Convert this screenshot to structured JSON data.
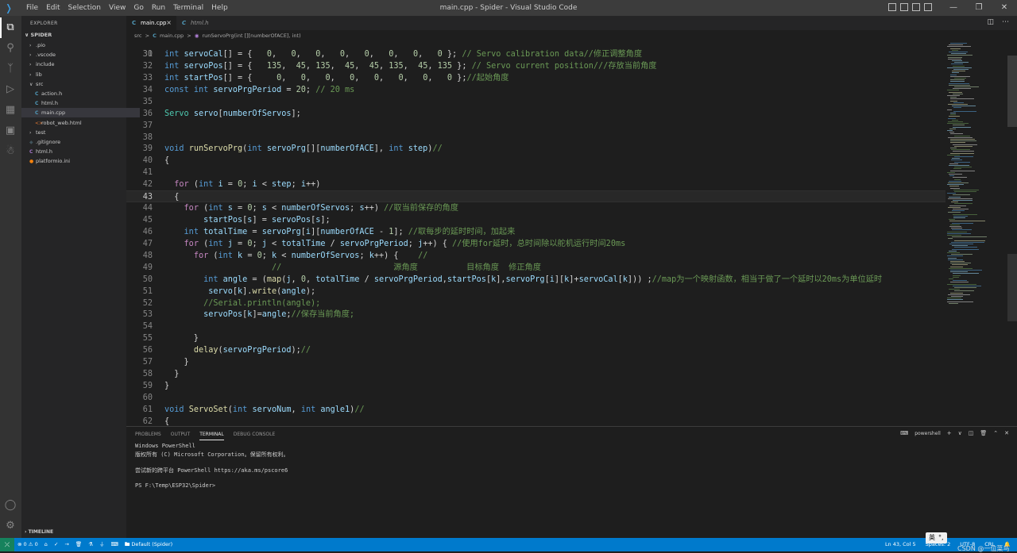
{
  "titlebar": {
    "menu": [
      "File",
      "Edit",
      "Selection",
      "View",
      "Go",
      "Run",
      "Terminal",
      "Help"
    ],
    "title": "main.cpp - Spider - Visual Studio Code"
  },
  "sidebar": {
    "title": "EXPLORER",
    "root": "SPIDER",
    "items": [
      {
        "label": ".pio",
        "type": "folder",
        "depth": 0
      },
      {
        "label": ".vscode",
        "type": "folder",
        "depth": 0
      },
      {
        "label": "include",
        "type": "folder",
        "depth": 0
      },
      {
        "label": "lib",
        "type": "folder",
        "depth": 0
      },
      {
        "label": "src",
        "type": "folder-open",
        "depth": 0
      },
      {
        "label": "action.h",
        "type": "c",
        "depth": 1
      },
      {
        "label": "html.h",
        "type": "c",
        "depth": 1
      },
      {
        "label": "main.cpp",
        "type": "c",
        "depth": 1,
        "selected": true
      },
      {
        "label": "robot_web.html",
        "type": "html",
        "depth": 1
      },
      {
        "label": "test",
        "type": "folder",
        "depth": 0
      },
      {
        "label": ".gitignore",
        "type": "git",
        "depth": 0
      },
      {
        "label": "html.h",
        "type": "h",
        "depth": 0
      },
      {
        "label": "platformio.ini",
        "type": "pio",
        "depth": 0
      }
    ],
    "timeline": "TIMELINE"
  },
  "tabs": [
    {
      "icon": "C",
      "label": "main.cpp"
    },
    {
      "icon": "C",
      "label": "html.h"
    }
  ],
  "breadcrumb": [
    "src",
    ">",
    "main.cpp",
    ">",
    "runServoPrg(int [][numberOfACE], int)"
  ],
  "editor": {
    "partial_line": "30",
    "lines": [
      {
        "n": "31",
        "code": "int servoCal[] = {   0,   0,   0,   0,   0,   0,   0,   0 }; // Servo calibration data//修正调整角度"
      },
      {
        "n": "32",
        "code": "int servoPos[] = {   135,  45, 135,  45,  45, 135,  45, 135 }; // Servo current position///存放当前角度"
      },
      {
        "n": "33",
        "code": "int startPos[] = {     0,   0,   0,   0,   0,   0,   0,   0 };//起始角度"
      },
      {
        "n": "34",
        "code": "const int servoPrgPeriod = 20; // 20 ms"
      },
      {
        "n": "35",
        "code": ""
      },
      {
        "n": "36",
        "code": "Servo servo[numberOfServos];"
      },
      {
        "n": "37",
        "code": ""
      },
      {
        "n": "38",
        "code": ""
      },
      {
        "n": "39",
        "code": "void runServoPrg(int servoPrg[][numberOfACE], int step)//"
      },
      {
        "n": "40",
        "code": "{"
      },
      {
        "n": "41",
        "code": ""
      },
      {
        "n": "42",
        "code": "  for (int i = 0; i < step; i++)"
      },
      {
        "n": "43",
        "code": "  {"
      },
      {
        "n": "44",
        "code": "    for (int s = 0; s < numberOfServos; s++) //取当前保存的角度"
      },
      {
        "n": "45",
        "code": "        startPos[s] = servoPos[s];"
      },
      {
        "n": "46",
        "code": "    int totalTime = servoPrg[i][numberOfACE - 1]; //取每步的延时时间，加起来"
      },
      {
        "n": "47",
        "code": "    for (int j = 0; j < totalTime / servoPrgPeriod; j++) { //使用for延时，总时间除以舵机运行时间20ms"
      },
      {
        "n": "48",
        "code": "      for (int k = 0; k < numberOfServos; k++) {    //"
      },
      {
        "n": "49",
        "code": "                      //                       源角度          目标角度  修正角度"
      },
      {
        "n": "50",
        "code": "        int angle = (map(j, 0, totalTime / servoPrgPeriod,startPos[k],servoPrg[i][k]+servoCal[k])) ;//map为一个映射函数，相当于做了一个延时以20ms为单位延时"
      },
      {
        "n": "51",
        "code": "         servo[k].write(angle);"
      },
      {
        "n": "52",
        "code": "        //Serial.println(angle);"
      },
      {
        "n": "53",
        "code": "        servoPos[k]=angle;//保存当前角度;"
      },
      {
        "n": "54",
        "code": ""
      },
      {
        "n": "55",
        "code": "      }"
      },
      {
        "n": "56",
        "code": "      delay(servoPrgPeriod);//"
      },
      {
        "n": "57",
        "code": "    }"
      },
      {
        "n": "58",
        "code": "  }"
      },
      {
        "n": "59",
        "code": "}"
      },
      {
        "n": "60",
        "code": ""
      },
      {
        "n": "61",
        "code": "void ServoSet(int servoNum, int angle1)//"
      },
      {
        "n": "62",
        "code": "{"
      }
    ]
  },
  "panel": {
    "tabs": [
      "PROBLEMS",
      "OUTPUT",
      "TERMINAL",
      "DEBUG CONSOLE"
    ],
    "active_tab": "TERMINAL",
    "shell": "powershell",
    "terminal_lines": [
      "Windows PowerShell",
      "版权所有 (C) Microsoft Corporation。保留所有权利。",
      "",
      "尝试新的跨平台 PowerShell https://aka.ms/pscore6",
      "",
      "PS F:\\Temp\\ESP32\\Spider>"
    ]
  },
  "statusbar": {
    "errors": "0",
    "warnings": "0",
    "env": "Default (Spider)",
    "position": "Ln 43, Col 5",
    "spaces": "Spaces: 2",
    "encoding": "UTF-8",
    "eol": "CRL"
  },
  "ime": {
    "label": "英"
  },
  "watermark": "CSDN @一位菜鸟"
}
